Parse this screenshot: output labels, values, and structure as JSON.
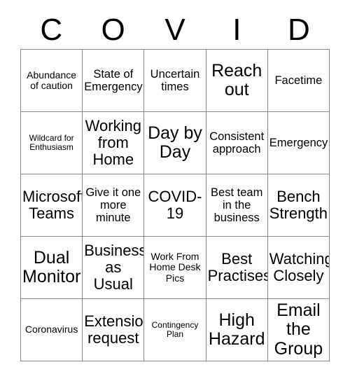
{
  "card": {
    "title_letters": [
      "C",
      "O",
      "V",
      "I",
      "D"
    ],
    "grid": {
      "columns": 5,
      "rows": 5,
      "border_color": "#8a8a8a",
      "background": "#ffffff",
      "text_color": "#000000"
    },
    "cells": [
      {
        "text": "Abundance of caution",
        "size": "sm"
      },
      {
        "text": "State of Emergency",
        "size": "md"
      },
      {
        "text": "Uncertain times",
        "size": "md"
      },
      {
        "text": "Reach out",
        "size": "xl"
      },
      {
        "text": "Facetime",
        "size": "md"
      },
      {
        "text": "Wildcard for Enthusiasm",
        "size": "xs"
      },
      {
        "text": "Working from Home",
        "size": "lg"
      },
      {
        "text": "Day by Day",
        "size": "xl"
      },
      {
        "text": "Consistent approach",
        "size": "md"
      },
      {
        "text": "Emergency",
        "size": "md"
      },
      {
        "text": "Microsoft Teams",
        "size": "lg"
      },
      {
        "text": "Give it one more minute",
        "size": "md"
      },
      {
        "text": "COVID-19",
        "size": "lg"
      },
      {
        "text": "Best team in the business",
        "size": "md"
      },
      {
        "text": "Bench Strength",
        "size": "lg"
      },
      {
        "text": "Dual Monitor",
        "size": "xl"
      },
      {
        "text": "Business as Usual",
        "size": "lg"
      },
      {
        "text": "Work From Home Desk Pics",
        "size": "sm"
      },
      {
        "text": "Best Practises",
        "size": "lg"
      },
      {
        "text": "Watching Closely",
        "size": "lg"
      },
      {
        "text": "Coronavirus",
        "size": "sm"
      },
      {
        "text": "Extension request",
        "size": "lg"
      },
      {
        "text": "Contingency Plan",
        "size": "xs"
      },
      {
        "text": "High Hazard",
        "size": "xl"
      },
      {
        "text": "Email the Group",
        "size": "xl"
      }
    ]
  }
}
